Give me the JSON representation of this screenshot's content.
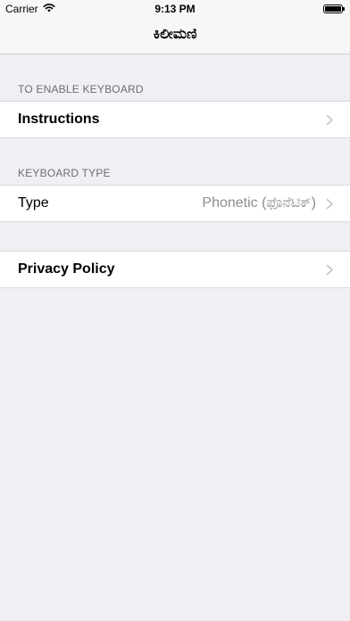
{
  "status_bar": {
    "carrier": "Carrier",
    "time": "9:13 PM",
    "battery_level": 1.0
  },
  "nav": {
    "title": "ಕಿಲೀಮಣಿ"
  },
  "sections": {
    "enable": {
      "header": "TO ENABLE KEYBOARD",
      "row_label": "Instructions"
    },
    "keyboard_type": {
      "header": "KEYBOARD TYPE",
      "row_label": "Type",
      "row_value": "Phonetic (ಫೊನೆಟಿಕ್)"
    },
    "privacy": {
      "row_label": "Privacy Policy"
    }
  },
  "icons": {
    "wifi": "wifi-icon",
    "battery": "battery-icon",
    "chevron": "chevron-right-icon"
  },
  "colors": {
    "background": "#efeff4",
    "secondary_text": "#8e8e93",
    "header_text": "#6d6d72",
    "chevron": "#c7c7cc"
  }
}
